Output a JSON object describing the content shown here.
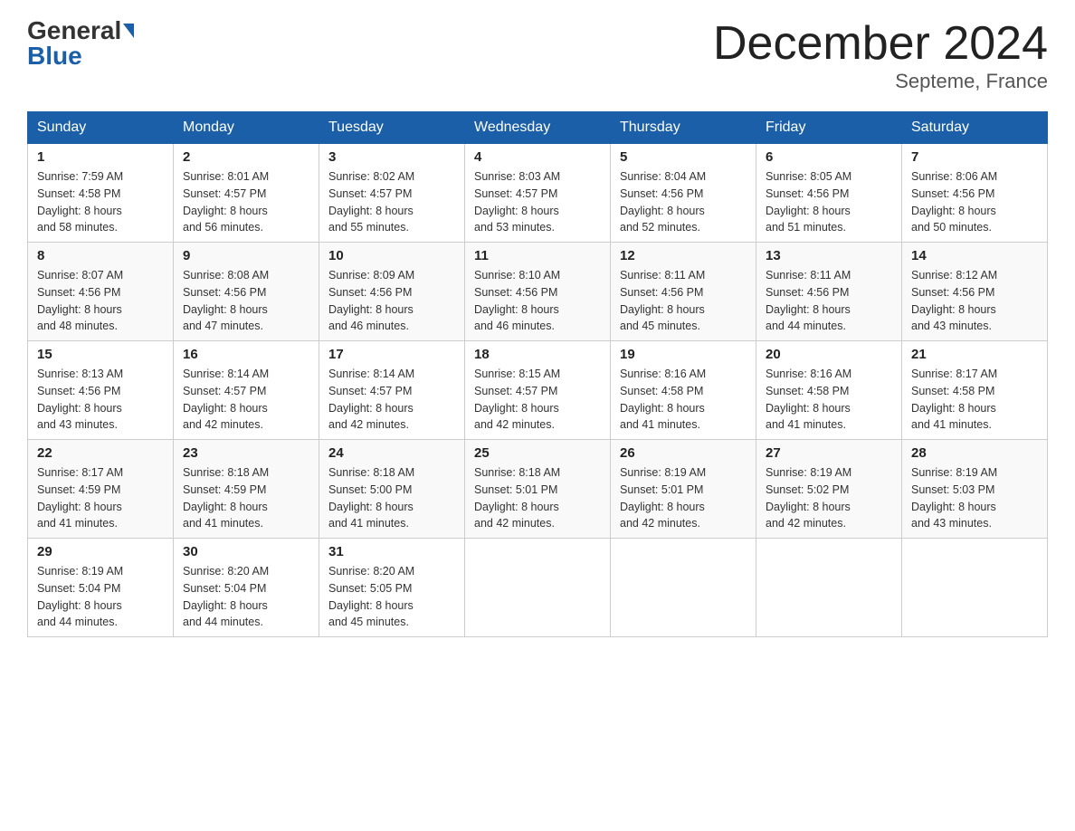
{
  "header": {
    "logo_general": "General",
    "logo_blue": "Blue",
    "title": "December 2024",
    "subtitle": "Septeme, France"
  },
  "days_of_week": [
    "Sunday",
    "Monday",
    "Tuesday",
    "Wednesday",
    "Thursday",
    "Friday",
    "Saturday"
  ],
  "weeks": [
    [
      {
        "day": "1",
        "sunrise": "7:59 AM",
        "sunset": "4:58 PM",
        "daylight": "8 hours and 58 minutes."
      },
      {
        "day": "2",
        "sunrise": "8:01 AM",
        "sunset": "4:57 PM",
        "daylight": "8 hours and 56 minutes."
      },
      {
        "day": "3",
        "sunrise": "8:02 AM",
        "sunset": "4:57 PM",
        "daylight": "8 hours and 55 minutes."
      },
      {
        "day": "4",
        "sunrise": "8:03 AM",
        "sunset": "4:57 PM",
        "daylight": "8 hours and 53 minutes."
      },
      {
        "day": "5",
        "sunrise": "8:04 AM",
        "sunset": "4:56 PM",
        "daylight": "8 hours and 52 minutes."
      },
      {
        "day": "6",
        "sunrise": "8:05 AM",
        "sunset": "4:56 PM",
        "daylight": "8 hours and 51 minutes."
      },
      {
        "day": "7",
        "sunrise": "8:06 AM",
        "sunset": "4:56 PM",
        "daylight": "8 hours and 50 minutes."
      }
    ],
    [
      {
        "day": "8",
        "sunrise": "8:07 AM",
        "sunset": "4:56 PM",
        "daylight": "8 hours and 48 minutes."
      },
      {
        "day": "9",
        "sunrise": "8:08 AM",
        "sunset": "4:56 PM",
        "daylight": "8 hours and 47 minutes."
      },
      {
        "day": "10",
        "sunrise": "8:09 AM",
        "sunset": "4:56 PM",
        "daylight": "8 hours and 46 minutes."
      },
      {
        "day": "11",
        "sunrise": "8:10 AM",
        "sunset": "4:56 PM",
        "daylight": "8 hours and 46 minutes."
      },
      {
        "day": "12",
        "sunrise": "8:11 AM",
        "sunset": "4:56 PM",
        "daylight": "8 hours and 45 minutes."
      },
      {
        "day": "13",
        "sunrise": "8:11 AM",
        "sunset": "4:56 PM",
        "daylight": "8 hours and 44 minutes."
      },
      {
        "day": "14",
        "sunrise": "8:12 AM",
        "sunset": "4:56 PM",
        "daylight": "8 hours and 43 minutes."
      }
    ],
    [
      {
        "day": "15",
        "sunrise": "8:13 AM",
        "sunset": "4:56 PM",
        "daylight": "8 hours and 43 minutes."
      },
      {
        "day": "16",
        "sunrise": "8:14 AM",
        "sunset": "4:57 PM",
        "daylight": "8 hours and 42 minutes."
      },
      {
        "day": "17",
        "sunrise": "8:14 AM",
        "sunset": "4:57 PM",
        "daylight": "8 hours and 42 minutes."
      },
      {
        "day": "18",
        "sunrise": "8:15 AM",
        "sunset": "4:57 PM",
        "daylight": "8 hours and 42 minutes."
      },
      {
        "day": "19",
        "sunrise": "8:16 AM",
        "sunset": "4:58 PM",
        "daylight": "8 hours and 41 minutes."
      },
      {
        "day": "20",
        "sunrise": "8:16 AM",
        "sunset": "4:58 PM",
        "daylight": "8 hours and 41 minutes."
      },
      {
        "day": "21",
        "sunrise": "8:17 AM",
        "sunset": "4:58 PM",
        "daylight": "8 hours and 41 minutes."
      }
    ],
    [
      {
        "day": "22",
        "sunrise": "8:17 AM",
        "sunset": "4:59 PM",
        "daylight": "8 hours and 41 minutes."
      },
      {
        "day": "23",
        "sunrise": "8:18 AM",
        "sunset": "4:59 PM",
        "daylight": "8 hours and 41 minutes."
      },
      {
        "day": "24",
        "sunrise": "8:18 AM",
        "sunset": "5:00 PM",
        "daylight": "8 hours and 41 minutes."
      },
      {
        "day": "25",
        "sunrise": "8:18 AM",
        "sunset": "5:01 PM",
        "daylight": "8 hours and 42 minutes."
      },
      {
        "day": "26",
        "sunrise": "8:19 AM",
        "sunset": "5:01 PM",
        "daylight": "8 hours and 42 minutes."
      },
      {
        "day": "27",
        "sunrise": "8:19 AM",
        "sunset": "5:02 PM",
        "daylight": "8 hours and 42 minutes."
      },
      {
        "day": "28",
        "sunrise": "8:19 AM",
        "sunset": "5:03 PM",
        "daylight": "8 hours and 43 minutes."
      }
    ],
    [
      {
        "day": "29",
        "sunrise": "8:19 AM",
        "sunset": "5:04 PM",
        "daylight": "8 hours and 44 minutes."
      },
      {
        "day": "30",
        "sunrise": "8:20 AM",
        "sunset": "5:04 PM",
        "daylight": "8 hours and 44 minutes."
      },
      {
        "day": "31",
        "sunrise": "8:20 AM",
        "sunset": "5:05 PM",
        "daylight": "8 hours and 45 minutes."
      },
      null,
      null,
      null,
      null
    ]
  ],
  "labels": {
    "sunrise_prefix": "Sunrise: ",
    "sunset_prefix": "Sunset: ",
    "daylight_prefix": "Daylight: "
  }
}
